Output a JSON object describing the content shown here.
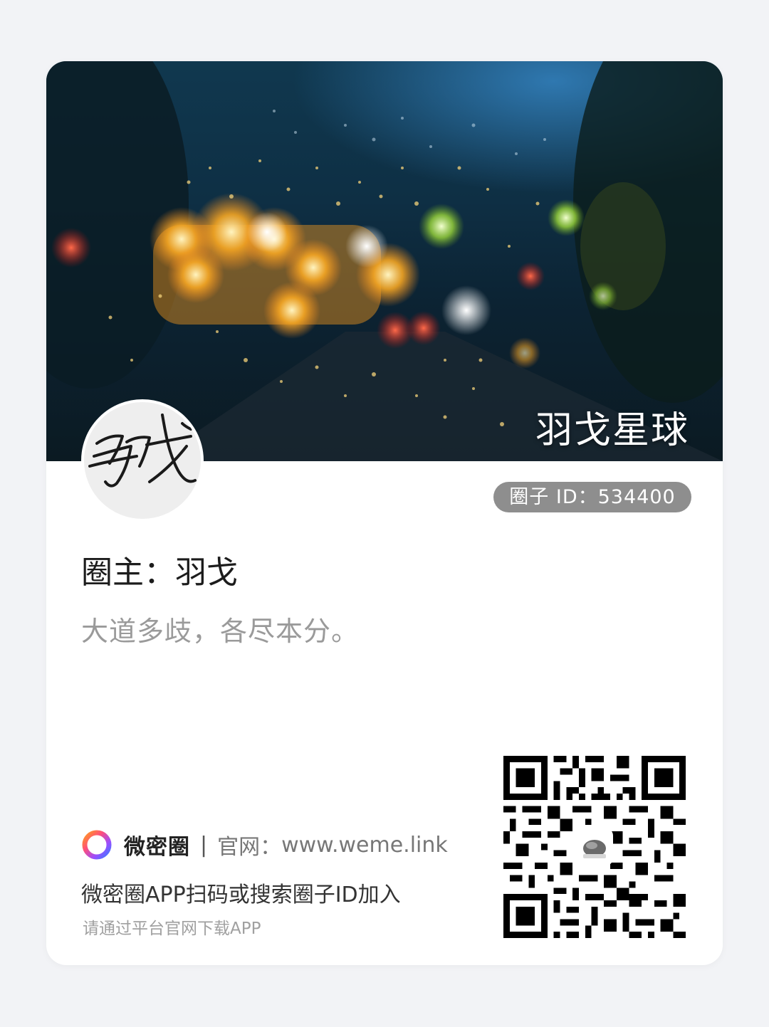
{
  "circle": {
    "name": "羽戈星球",
    "id_label": "圈子 ID：",
    "id_value": "534400",
    "owner_label": "圈主：",
    "owner_name": "羽戈",
    "motto": "大道多歧，各尽本分。",
    "avatar_text": "羽戈"
  },
  "footer": {
    "brand_name": "微密圈",
    "separator": "|",
    "site_label": "官网：",
    "site_url": "www.weme.link",
    "scan_text": "微密圈APP扫码或搜索圈子ID加入",
    "download_text": "请通过平台官网下载APP"
  },
  "icons": {
    "brand_logo": "ring-gradient-logo",
    "qr_code": "qr-code-icon"
  },
  "colors": {
    "page_bg": "#f2f3f6",
    "card_bg": "#ffffff",
    "pill_bg": "#8e8e8e",
    "motto_text": "#9a9a9a"
  }
}
